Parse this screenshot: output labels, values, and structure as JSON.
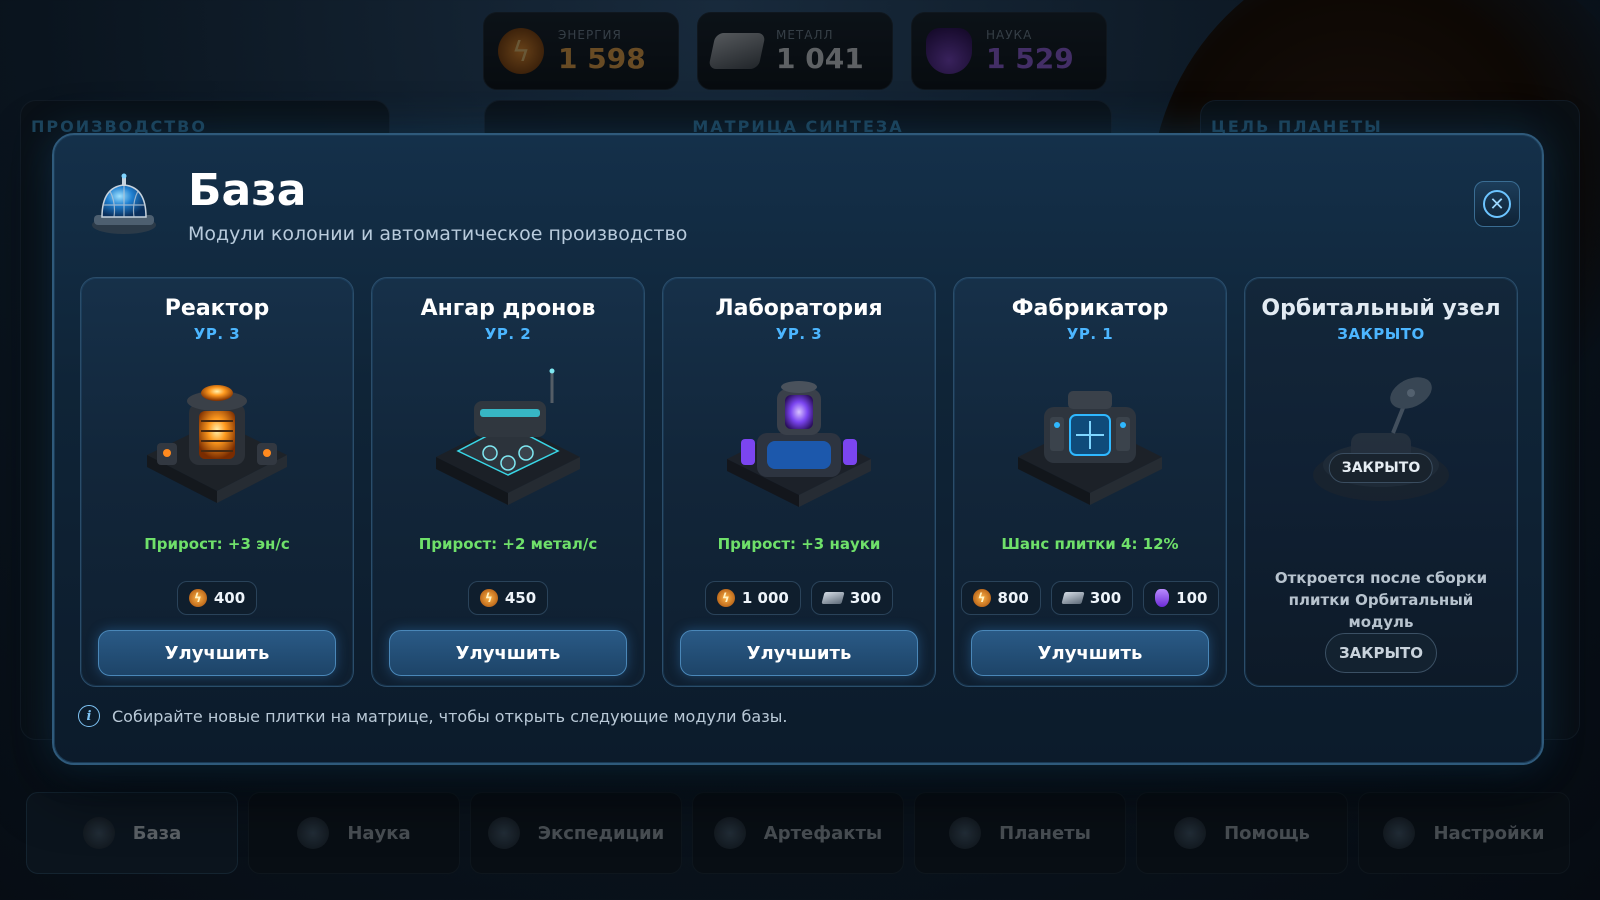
{
  "resources": [
    {
      "key": "energy",
      "label": "ЭНЕРГИЯ",
      "value": "1 598",
      "icon": "lightning-icon",
      "color": "#ffb24a"
    },
    {
      "key": "metal",
      "label": "МЕТАЛЛ",
      "value": "1 041",
      "icon": "metal-ingot-icon",
      "color": "#dfe7ef"
    },
    {
      "key": "science",
      "label": "НАУКА",
      "value": "1 529",
      "icon": "flask-icon",
      "color": "#a46bff"
    }
  ],
  "background_panels": {
    "left_title": "ПРОИЗВОДСТВО",
    "center_title": "МАТРИЦА СИНТЕЗА",
    "right_title": "ЦЕЛЬ ПЛАНЕТЫ"
  },
  "bottom_nav": [
    {
      "label": "База",
      "icon": "dome-icon",
      "active": true
    },
    {
      "label": "Наука",
      "icon": "flask-icon",
      "active": false
    },
    {
      "label": "Экспедиции",
      "icon": "rocket-icon",
      "active": false
    },
    {
      "label": "Артефакты",
      "icon": "artifact-icon",
      "active": false
    },
    {
      "label": "Планеты",
      "icon": "planet-icon",
      "active": false
    },
    {
      "label": "Помощь",
      "icon": "help-icon",
      "active": false
    },
    {
      "label": "Настройки",
      "icon": "gear-icon",
      "active": false
    }
  ],
  "modal": {
    "title": "База",
    "subtitle": "Модули колонии и автоматическое производство",
    "close_icon": "close-icon",
    "hint": "Собирайте новые плитки на матрице, чтобы открыть следующие модули базы.",
    "modules": [
      {
        "name": "Реактор",
        "level": "УР. 3",
        "yield": "Прирост: +3 эн/с",
        "art": "reactor",
        "accent": "#ff8a1f",
        "costs": [
          {
            "type": "energy",
            "amount": "400"
          }
        ],
        "button": "Улучшить"
      },
      {
        "name": "Ангар дронов",
        "level": "УР. 2",
        "yield": "Прирост: +2 метал/с",
        "art": "hangar",
        "accent": "#39d6e6",
        "costs": [
          {
            "type": "energy",
            "amount": "450"
          }
        ],
        "button": "Улучшить"
      },
      {
        "name": "Лаборатория",
        "level": "УР. 3",
        "yield": "Прирост: +3 науки",
        "art": "lab",
        "accent": "#8d5bff",
        "costs": [
          {
            "type": "energy",
            "amount": "1 000"
          },
          {
            "type": "metal",
            "amount": "300"
          }
        ],
        "button": "Улучшить"
      },
      {
        "name": "Фабрикатор",
        "level": "УР. 1",
        "yield": "Шанс плитки 4: 12%",
        "art": "fabricator",
        "accent": "#2fb8ff",
        "costs": [
          {
            "type": "energy",
            "amount": "800"
          },
          {
            "type": "metal",
            "amount": "300"
          },
          {
            "type": "science",
            "amount": "100"
          }
        ],
        "button": "Улучшить"
      },
      {
        "name": "Орбитальный узел",
        "level": "ЗАКРЫТО",
        "locked": true,
        "art": "orbital",
        "accent": "#6a7a88",
        "lock_badge": "ЗАКРЫТО",
        "lock_note": "Откроется после сборки плитки Орбитальный модуль",
        "button": "ЗАКРЫТО"
      }
    ]
  }
}
